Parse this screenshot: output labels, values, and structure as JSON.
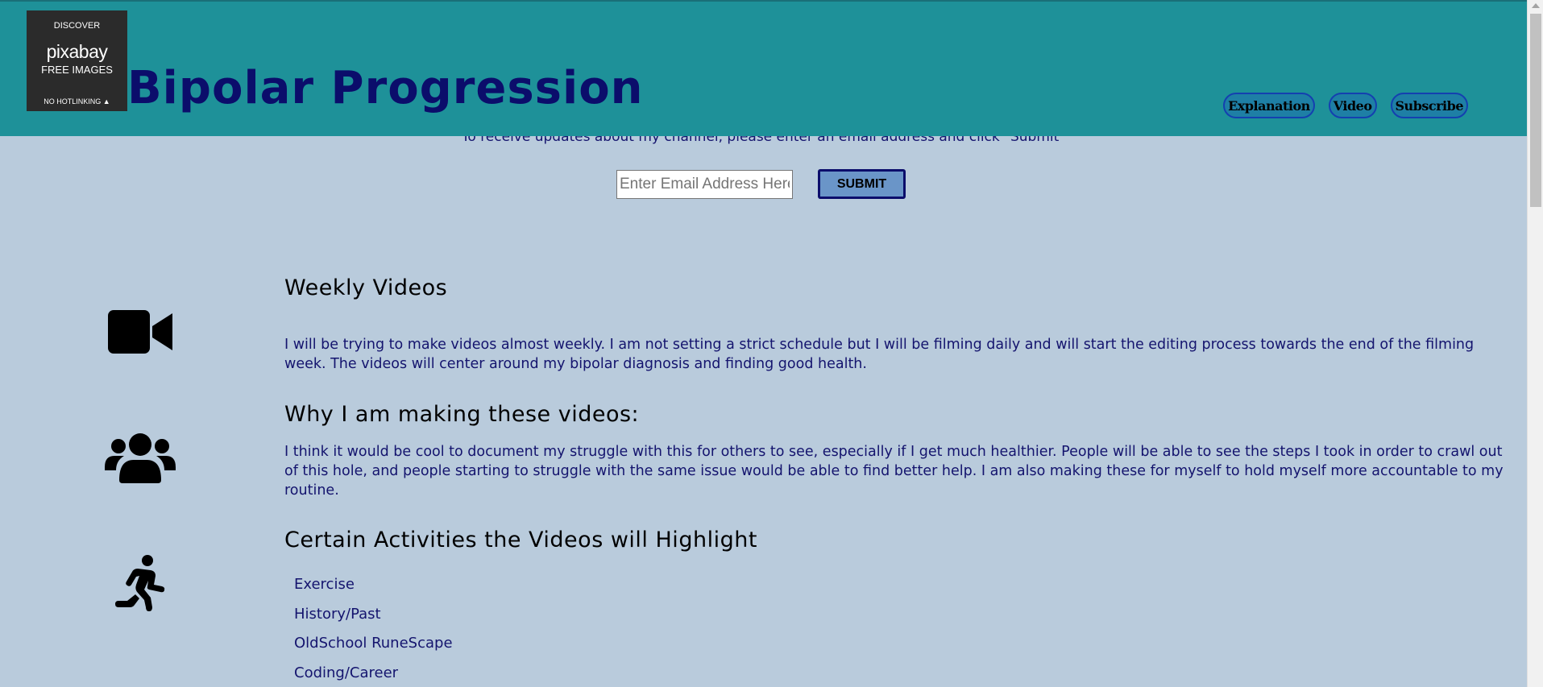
{
  "logo": {
    "discover": "DISCOVER",
    "brand": "pixabay",
    "free": "FREE IMAGES",
    "hotlink": "NO HOTLINKING ▲"
  },
  "header": {
    "title": "Bipolar Progression",
    "nav": [
      "Explanation",
      "Video",
      "Subscribe"
    ]
  },
  "subscribe": {
    "text": "To receive updates about my channel, please enter an email address and click \"Submit\"",
    "email_placeholder": "Enter Email Address Here",
    "submit_label": "SUBMIT"
  },
  "sections": [
    {
      "icon": "video-camera-icon",
      "heading": "Weekly Videos",
      "text": "I will be trying to make videos almost weekly. I am not setting a strict schedule but I will be filming daily and will start the editing process towards the end of the filming week. The videos will center around my bipolar diagnosis and finding good health."
    },
    {
      "icon": "users-icon",
      "heading": "Why I am making these videos:",
      "text": "I think it would be cool to document my struggle with this for others to see, especially if I get much healthier. People will be able to see the steps I took in order to crawl out of this hole, and people starting to struggle with the same issue would be able to find better help. I am also making these for myself to hold myself more accountable to my routine."
    },
    {
      "icon": "running-person-icon",
      "heading": "Certain Activities the Videos will Highlight",
      "items": [
        "Exercise",
        "History/Past",
        "OldSchool RuneScape",
        "Coding/Career"
      ]
    }
  ]
}
